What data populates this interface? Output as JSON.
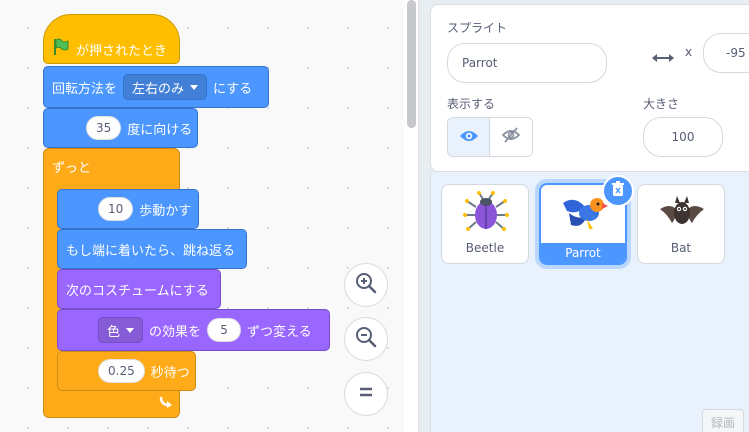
{
  "script": {
    "hat_label": "が押されたとき",
    "rotation": {
      "prefix": "回転方法を",
      "option": "左右のみ",
      "suffix": "にする"
    },
    "point": {
      "value": "35",
      "label": "度に向ける"
    },
    "forever_label": "ずっと",
    "move": {
      "value": "10",
      "label": "歩動かす"
    },
    "bounce_label": "もし端に着いたら、跳ね返る",
    "next_costume_label": "次のコスチュームにする",
    "effect": {
      "option": "色",
      "mid": "の効果を",
      "value": "5",
      "suffix": "ずつ変える"
    },
    "wait": {
      "value": "0.25",
      "label": "秒待つ"
    }
  },
  "sprite_info": {
    "sprite_label": "スプライト",
    "sprite_name": "Parrot",
    "x_label": "x",
    "x_value": "-95",
    "show_label": "表示する",
    "size_label": "大きさ",
    "size_value": "100"
  },
  "sprites": [
    {
      "name": "Beetle",
      "icon": "beetle-icon"
    },
    {
      "name": "Parrot",
      "icon": "parrot-icon",
      "selected": true
    },
    {
      "name": "Bat",
      "icon": "bat-icon"
    }
  ],
  "record_label": "録画",
  "colors": {
    "events": "#ffbf00",
    "motion": "#4c97ff",
    "looks": "#9966ff",
    "control": "#ffab19",
    "accent": "#4c97ff"
  }
}
